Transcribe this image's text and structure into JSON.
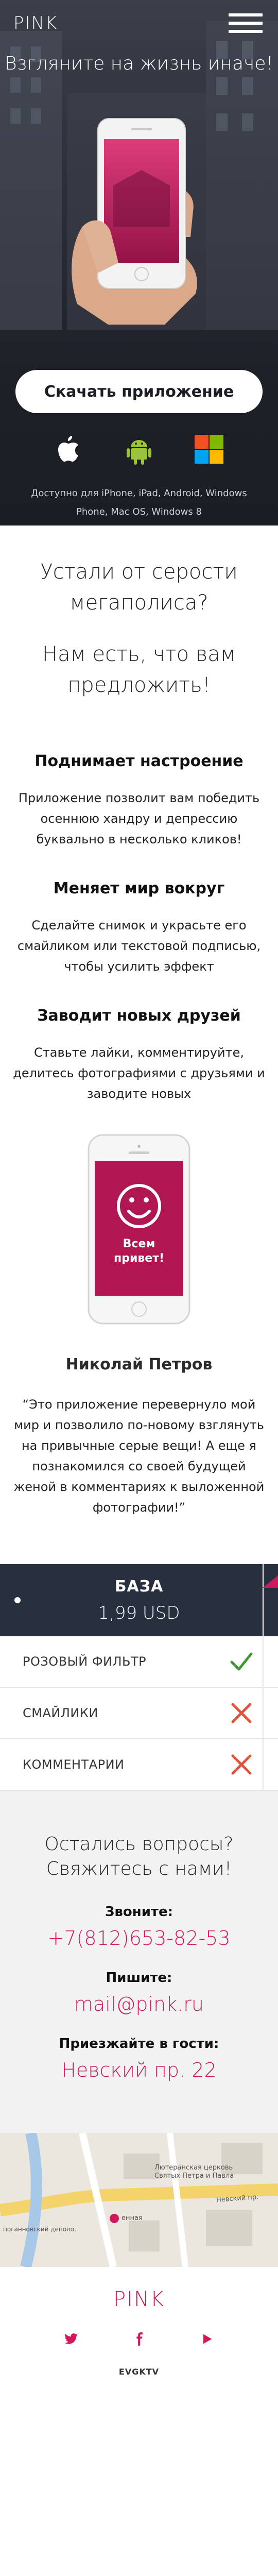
{
  "header": {
    "logo": "PINK"
  },
  "hero": {
    "title": "Взгляните на жизнь иначе!",
    "download_label": "Скачать приложение",
    "platforms_text": "Доступно для iPhone, iPad, Android, Windows Phone, Mac OS, Windows 8",
    "platforms": [
      "apple-icon",
      "android-icon",
      "windows-icon"
    ]
  },
  "intro": {
    "line1": "Устали от серости мегаполиса?",
    "line2": "Нам есть, что вам предложить!"
  },
  "features": [
    {
      "title": "Поднимает настроение",
      "text": "Приложение позволит вам победить осеннюю хандру и депрессию буквально в несколько кликов!"
    },
    {
      "title": "Меняет мир вокруг",
      "text": "Сделайте снимок и украсьте его смайликом или текстовой подписью, чтобы усилить эффект"
    },
    {
      "title": "Заводит новых друзей",
      "text": "Ставьте лайки, комментируйте, делитесь фотографиями с друзьями и заводите новых"
    }
  ],
  "phone_screen": {
    "text": "Всем привет!"
  },
  "testimonial": {
    "author": "Николай Петров",
    "quote": "“Это приложение перевернуло мой мир и позволило по-новому взглянуть на привычные серые вещи! А еще я познакомился со своей будущей женой в комментариях к выложенной фотографии!”"
  },
  "pricing": {
    "plan": "БАЗА",
    "price": "1,99 USD",
    "rows": [
      {
        "label": "РОЗОВЫЙ ФИЛЬТР",
        "included": true
      },
      {
        "label": "СМАЙЛИКИ",
        "included": false
      },
      {
        "label": "КОММЕНТАРИИ",
        "included": false
      }
    ]
  },
  "contacts": {
    "heading": "Остались вопросы? Свяжитесь с нами!",
    "call_title": "Звоните:",
    "phone": "+7(812)653-82-53",
    "write_title": "Пишите:",
    "email": "mail@pink.ru",
    "visit_title": "Приезжайте в гости:",
    "address": "Невский пр. 22"
  },
  "map": {
    "label_church": "Лютеранская церковь Святых Петра и Павла",
    "label_street": "Невский пр.",
    "label_marker": "енная",
    "label_left": "поганновский деполо."
  },
  "footer": {
    "logo": "PINK",
    "credit": "EVGKTV",
    "socials": [
      "twitter-icon",
      "facebook-icon",
      "youtube-icon"
    ]
  },
  "colors": {
    "accent": "#d0185e",
    "dark": "#283040",
    "check": "#3a9a2e",
    "cross": "#e0533a"
  }
}
